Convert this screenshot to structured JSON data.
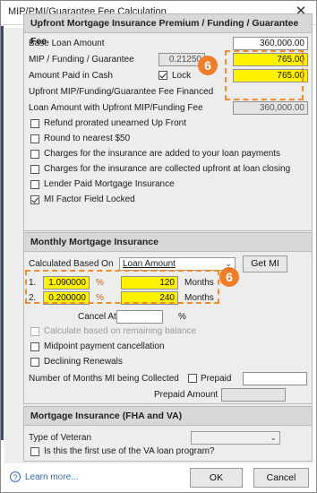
{
  "window": {
    "title": "MIP/PMI/Guarantee Fee Calculation",
    "close_glyph": "✕"
  },
  "upfront": {
    "header": "Upfront Mortgage Insurance Premium / Funding / Guarantee Fee",
    "base_loan_label": "Base Loan Amount",
    "base_loan_value": "360,000.00",
    "mip_label": "MIP / Funding / Guarantee",
    "mip_rate": "0.21250",
    "mip_amount": "765.00",
    "paid_cash_label": "Amount Paid in Cash",
    "lock_label": "Lock",
    "paid_cash_value": "765.00",
    "financed_label": "Upfront MIP/Funding/Guarantee Fee Financed",
    "loan_with_fee_label": "Loan Amount with Upfront MIP/Funding Fee",
    "loan_with_fee_value": "360,000.00",
    "checkboxes": [
      {
        "label": "Refund prorated unearned Up Front",
        "checked": false
      },
      {
        "label": "Round to nearest $50",
        "checked": false
      },
      {
        "label": "Charges for the insurance are added to your loan payments",
        "checked": false
      },
      {
        "label": "Charges for the insurance are collected upfront at loan closing",
        "checked": false
      },
      {
        "label": "Lender Paid Mortgage Insurance",
        "checked": false
      },
      {
        "label": "MI Factor Field Locked",
        "checked": true
      }
    ]
  },
  "monthly": {
    "header": "Monthly Mortgage Insurance",
    "calc_based_label": "Calculated Based On",
    "calc_based_value": "Loan Amount",
    "get_mi_label": "Get MI",
    "rows": [
      {
        "num": "1.",
        "rate": "1.090000",
        "pct": "%",
        "months": "120",
        "unit": "Months"
      },
      {
        "num": "2.",
        "rate": "0.200000",
        "pct": "%",
        "months": "240",
        "unit": "Months"
      }
    ],
    "cancel_at_label": "Cancel At",
    "cancel_pct": "%",
    "remaining_balance_label": "Calculate based on remaining balance",
    "midpoint_label": "Midpoint payment cancellation",
    "declining_label": "Declining Renewals",
    "months_collected_label": "Number of Months MI being Collected",
    "prepaid_label": "Prepaid",
    "prepaid_amount_label": "Prepaid Amount"
  },
  "fha_va": {
    "header": "Mortgage Insurance (FHA and VA)",
    "veteran_label": "Type of Veteran",
    "first_use_label": "Is this the first use of the VA loan program?"
  },
  "annotation": {
    "badge_1": "6",
    "badge_2": "6",
    "color": "#f07d2a"
  },
  "footer": {
    "help_glyph": "?",
    "learn_more": "Learn more...",
    "ok": "OK",
    "cancel": "Cancel"
  }
}
